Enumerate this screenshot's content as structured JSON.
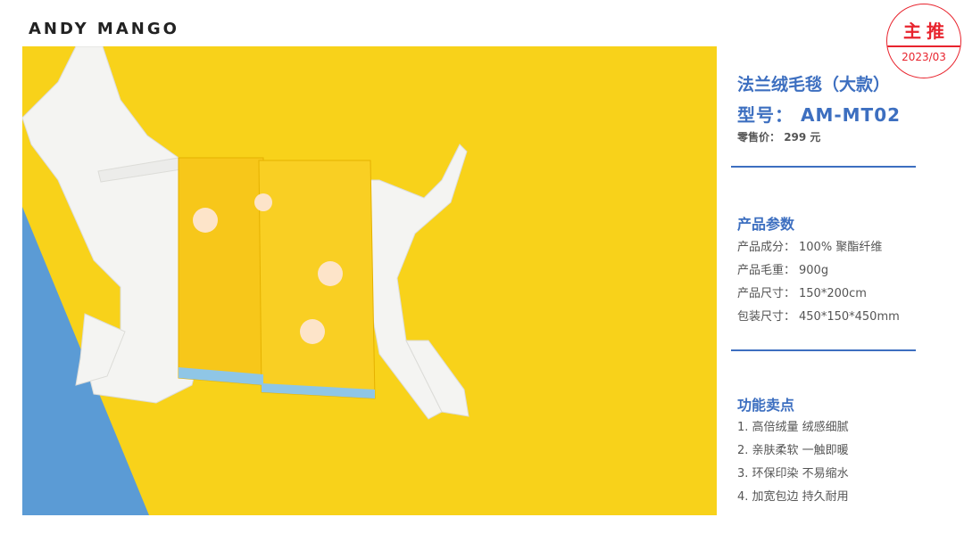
{
  "brand": {
    "logo_text": "ANDY MANGO"
  },
  "stamp": {
    "title": "主推",
    "date": "2023/03"
  },
  "product": {
    "name": "法兰绒毛毯（大款）",
    "model_label": "型号：",
    "model_value": "AM-MT02",
    "price_label": "零售价：",
    "price_value": "299 元"
  },
  "specs": {
    "title": "产品参数",
    "rows": [
      {
        "key": "产品成分：",
        "value": "100% 聚酯纤维"
      },
      {
        "key": "产品毛重：",
        "value": "900g"
      },
      {
        "key": "产品尺寸：",
        "value": "150*200cm"
      },
      {
        "key": "包装尺寸：",
        "value": "450*150*450mm"
      }
    ]
  },
  "features": {
    "title": "功能卖点",
    "items": [
      "1. 高倍绒量 绒感细腻",
      "2. 亲肤柔软 一触即暖",
      "3. 环保印染 不易缩水",
      "4. 加宽包边 持久耐用"
    ]
  },
  "colors": {
    "accent": "#3d6fc0",
    "stamp_red": "#e8242e",
    "background_yellow": "#f8d21a",
    "corner_blue": "#5b9bd5"
  },
  "photo": {
    "subject": "dog-mannequin-with-towels"
  }
}
